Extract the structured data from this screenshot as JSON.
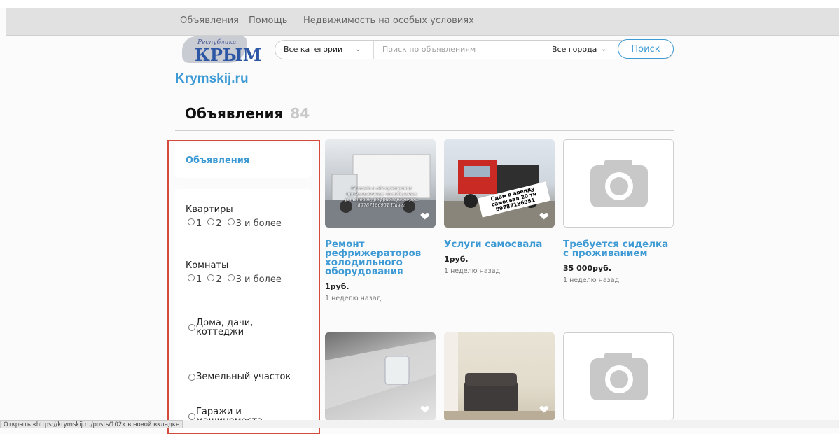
{
  "nav": {
    "links": [
      "Объявления",
      "Помощь",
      "Недвижимость на особых условиях"
    ]
  },
  "logo": {
    "small": "Республика",
    "big": "КРЫМ",
    "site": "Krymskij.ru"
  },
  "search": {
    "category": "Все категории",
    "placeholder": "Поиск по объявлениям",
    "city": "Все города",
    "button": "Поиск"
  },
  "page": {
    "title": "Объявления",
    "count": "84"
  },
  "sidebar": {
    "header": "Объявления",
    "apartments": {
      "title": "Квартиры",
      "options": [
        "1",
        "2",
        "3 и более"
      ]
    },
    "rooms": {
      "title": "Комнаты",
      "options": [
        "1",
        "2",
        "3 и более"
      ]
    },
    "categories": [
      "Дома, дачи, коттеджи",
      "Земельный участок",
      "Гаражи и машиноместа"
    ]
  },
  "listings": [
    {
      "title": "Ремонт рефрижераторов холодильного оборудования",
      "price": "1руб.",
      "time": "1 неделю назад",
      "image_text": "Ремонт и обслуживание промышленных холодильных установок, рефрижераторов. 89787186951 Павел"
    },
    {
      "title": "Услуги самосвала",
      "price": "1руб.",
      "time": "1 неделю назад",
      "image_text": "Сдам в аренду самосвал 20 тн 89787186951"
    },
    {
      "title": "Требуется сиделка с проживанием",
      "price": "35 000руб.",
      "time": "1 неделю назад"
    }
  ],
  "status": {
    "link_hint": "Открыть «https://krymskij.ru/posts/102» в новой вкладке"
  },
  "colors": {
    "accent": "#3e9ad4",
    "highlight_border": "#d64a3a",
    "nav_bg": "#e1e1e1"
  },
  "icons": [
    "heart-icon",
    "camera-icon",
    "chevron-down-icon"
  ]
}
